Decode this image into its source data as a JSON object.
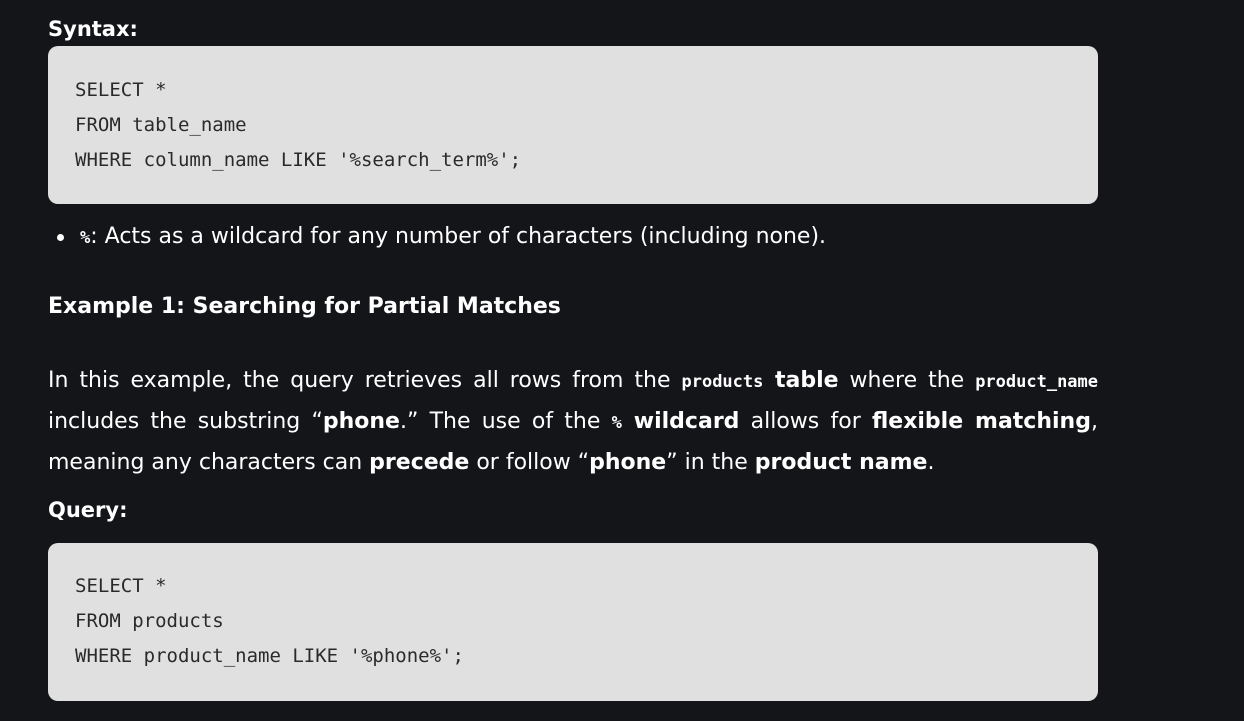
{
  "syntax_label": "Syntax:",
  "syntax_code": [
    "SELECT *",
    "FROM table_name",
    "WHERE column_name LIKE '%search_term%';"
  ],
  "bullet": {
    "code": "%",
    "text": ": Acts as a wildcard for any number of characters (including none)."
  },
  "example_heading": "Example 1: Searching for Partial Matches",
  "paragraph": {
    "p1": "In this example, the query retrieves all rows from the ",
    "code_products": "products",
    "b_table": " table",
    "p2": " where the ",
    "code_product_name": "product_name",
    "p3": " includes the substring “",
    "b_phone1": "phone",
    "p4": ".” The use of the ",
    "code_percent": "%",
    "b_wildcard": " wildcard",
    "p5": " allows for ",
    "b_flexible": "flexible matching",
    "p6": ", meaning any characters can ",
    "b_precede": "precede",
    "p7": " or follow “",
    "b_phone2": "phone",
    "p8": "” in the ",
    "b_product_name": "product name",
    "p9": "."
  },
  "query_label": "Query:",
  "query_code": [
    "SELECT *",
    "FROM products",
    "WHERE product_name LIKE '%phone%';"
  ]
}
